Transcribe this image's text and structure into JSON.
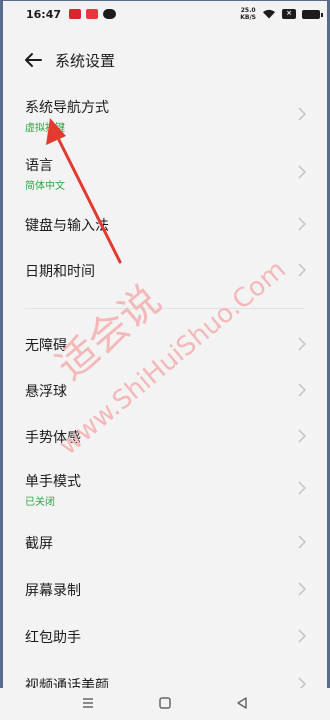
{
  "status": {
    "time": "16:47",
    "speed_value": "25.0",
    "speed_unit": "KB/S"
  },
  "header": {
    "title": "系统设置"
  },
  "items": [
    {
      "label": "系统导航方式",
      "sub": "虚拟按键"
    },
    {
      "label": "语言",
      "sub": "简体中文"
    },
    {
      "label": "键盘与输入法"
    },
    {
      "label": "日期和时间"
    },
    {
      "label": "无障碍"
    },
    {
      "label": "悬浮球"
    },
    {
      "label": "手势体感"
    },
    {
      "label": "单手模式",
      "sub": "已关闭"
    },
    {
      "label": "截屏"
    },
    {
      "label": "屏幕录制"
    },
    {
      "label": "红包助手"
    },
    {
      "label": "视频通话美颜"
    }
  ],
  "watermark": {
    "text_cn": "适会说",
    "text_en": "www.ShiHuiShuo.Com"
  },
  "colors": {
    "accent_green": "#2aa744",
    "arrow_red": "#e23a2e",
    "watermark": "#f4b8b8"
  }
}
